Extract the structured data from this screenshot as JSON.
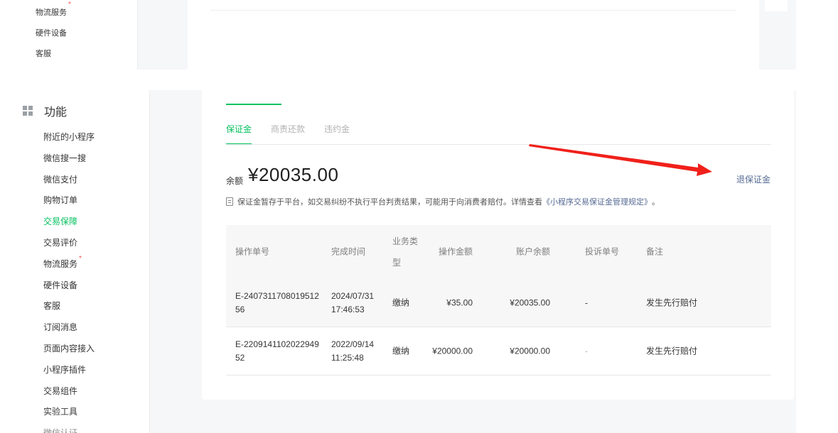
{
  "top_strip": {
    "items": [
      "物流服务",
      "硬件设备",
      "客服"
    ],
    "required_mark": "*"
  },
  "sidebar": {
    "section_title": "功能",
    "items": [
      {
        "label": "附近的小程序"
      },
      {
        "label": "微信搜一搜"
      },
      {
        "label": "微信支付"
      },
      {
        "label": "购物订单"
      },
      {
        "label": "交易保障"
      },
      {
        "label": "交易评价"
      },
      {
        "label": "物流服务"
      },
      {
        "label": "硬件设备"
      },
      {
        "label": "客服"
      },
      {
        "label": "订阅消息"
      },
      {
        "label": "页面内容接入"
      },
      {
        "label": "小程序插件"
      },
      {
        "label": "交易组件"
      },
      {
        "label": "实验工具"
      },
      {
        "label": "微信认证"
      }
    ],
    "active_item": "交易保障",
    "required_mark": "*"
  },
  "tabs": [
    {
      "label": "保证金"
    },
    {
      "label": "商责还款"
    },
    {
      "label": "违约金"
    }
  ],
  "balance": {
    "label": "余额",
    "value": "¥20035.00",
    "withdraw_link": "退保证金"
  },
  "notice": {
    "text": "保证金暂存于平台，如交易纠纷不执行平台判责结果，可能用于向消费者赔付。详情查看",
    "link": "《小程序交易保证金管理规定》",
    "suffix": "。"
  },
  "table": {
    "columns": [
      "操作单号",
      "完成时间",
      "业务类型",
      "操作金额",
      "账户余额",
      "投诉单号",
      "备注"
    ],
    "rows": [
      {
        "id": "E-240731170801951256",
        "time": "2024/07/31 17:46:53",
        "type": "缴纳",
        "amount": "¥35.00",
        "balance": "¥20035.00",
        "complaint": "-",
        "note": "发生先行赔付"
      },
      {
        "id": "E-220914110202294952",
        "time": "2022/09/14 11:25:48",
        "type": "缴纳",
        "amount": "¥20000.00",
        "balance": "¥20000.00",
        "complaint": "-",
        "note": "发生先行赔付"
      }
    ]
  },
  "colors": {
    "accent": "#07c160",
    "link": "#576b95",
    "required": "#fa5151",
    "annotation_arrow": "#f0201a"
  }
}
